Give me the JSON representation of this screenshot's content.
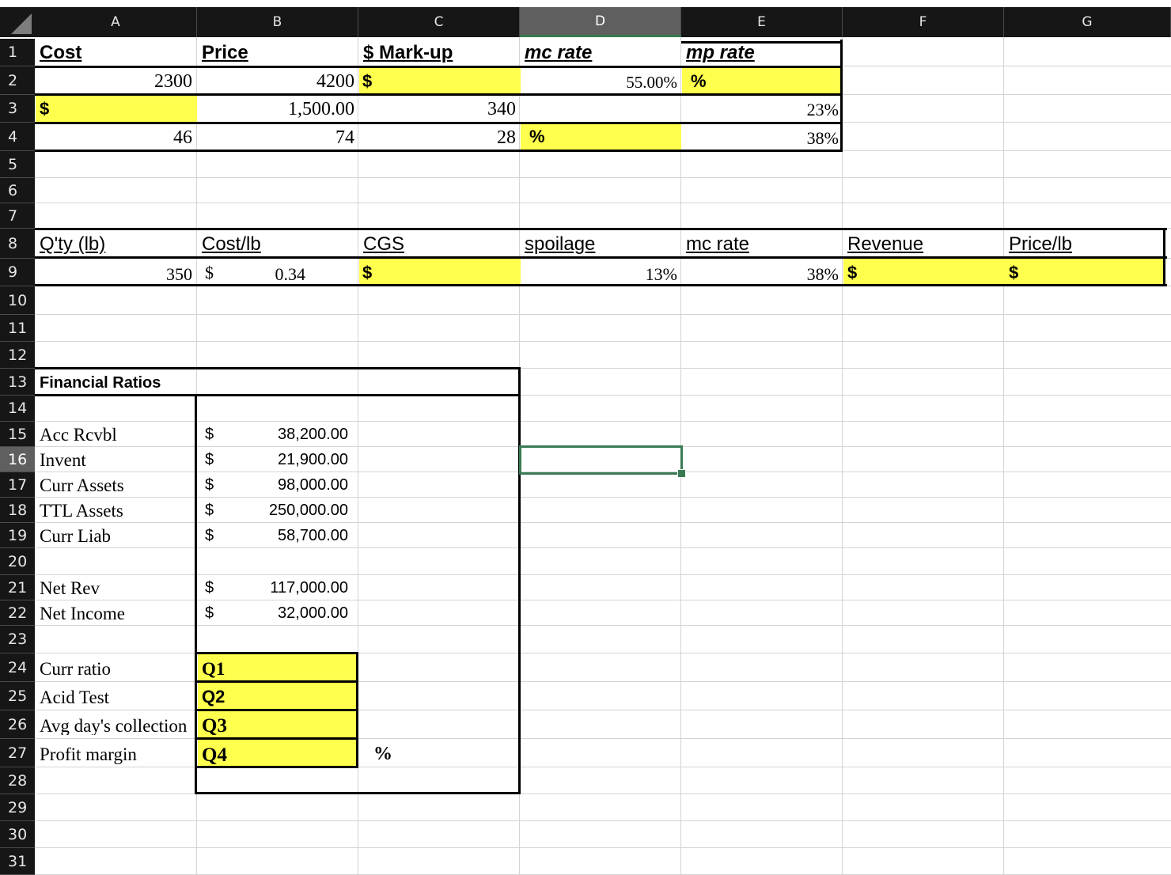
{
  "columns": [
    "A",
    "B",
    "C",
    "D",
    "E",
    "F",
    "G"
  ],
  "selected_column": "D",
  "selected_row": "16",
  "rows": [
    "1",
    "2",
    "3",
    "4",
    "5",
    "6",
    "7",
    "8",
    "9",
    "10",
    "11",
    "12",
    "13",
    "14",
    "15",
    "16",
    "17",
    "18",
    "19",
    "20",
    "21",
    "22",
    "23",
    "24",
    "25",
    "26",
    "27",
    "28",
    "29",
    "30",
    "31"
  ],
  "cells": {
    "A1": "Cost",
    "B1": "Price",
    "C1": "$ Mark-up",
    "D1": "mc rate",
    "E1": "mp rate",
    "A2": "2300",
    "B2": "4200",
    "B2_sym": "$",
    "D2": "55.00%",
    "D2_sym": "%",
    "A3_sym": "$",
    "B3": "1,500.00",
    "C3": "340",
    "E3": "23%",
    "A4": "46",
    "B4": "74",
    "C4": "28",
    "C4_sym": "%",
    "E4": "38%",
    "A8": "Q'ty (lb)",
    "B8": "Cost/lb",
    "C8": "CGS",
    "D8": "spoilage",
    "E8": "mc rate",
    "F8": "Revenue",
    "G8": "Price/lb",
    "A9": "350",
    "B9_sym": "$",
    "B9": "0.34",
    "C9_sym": "$",
    "D9": "13%",
    "E9": "38%",
    "F9_sym": "$",
    "G9_sym": "$",
    "A13": "Financial Ratios",
    "A15": "Acc Rcvbl",
    "A16": "Invent",
    "A17": "Curr Assets",
    "A18": "TTL Assets",
    "A19": "Curr Liab",
    "A21": "Net Rev",
    "A22": "Net Income",
    "currency_symbol": "$",
    "B15": "38,200.00",
    "B16": "21,900.00",
    "B17": "98,000.00",
    "B18": "250,000.00",
    "B19": "58,700.00",
    "B21": "117,000.00",
    "B22": "32,000.00",
    "A24": "Curr ratio",
    "A25": "Acid Test",
    "A26": "Avg day's collection",
    "A27": "Profit margin",
    "B24": "Q1",
    "B25": "Q2",
    "B26": "Q3",
    "B27": "Q4",
    "C27": "%"
  },
  "colors": {
    "highlight": "#ffff4d",
    "header_bg": "#161616",
    "selection": "#3a7a52"
  }
}
